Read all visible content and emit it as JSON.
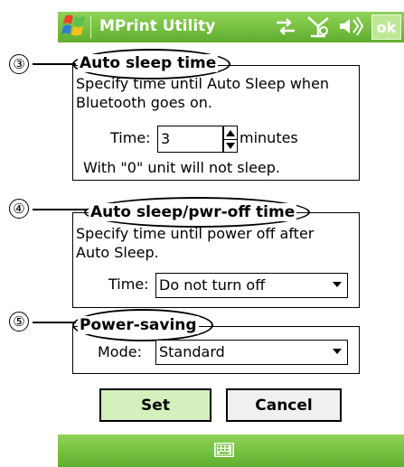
{
  "titlebar": {
    "app_title": "MPrint Utility",
    "ok_label": "ok",
    "icons": [
      "windows-logo",
      "connectivity-icon",
      "network-off-icon",
      "volume-icon"
    ]
  },
  "callouts": {
    "c3": "③",
    "c4": "④",
    "c5": "⑤"
  },
  "auto_sleep": {
    "title": "Auto sleep time",
    "description_line1": "Specify time until Auto Sleep when",
    "description_line2": "Bluetooth goes on.",
    "time_label": "Time:",
    "time_value": "3",
    "unit_label": "minutes",
    "note": "With \"0\" unit will not sleep."
  },
  "auto_off": {
    "title": "Auto sleep/pwr-off time",
    "description_line1": "Specify time until power off after",
    "description_line2": "Auto Sleep.",
    "time_label": "Time:",
    "selected": "Do not turn off"
  },
  "power_saving": {
    "title": "Power-saving",
    "mode_label": "Mode:",
    "selected": "Standard"
  },
  "buttons": {
    "set": "Set",
    "cancel": "Cancel"
  },
  "colors": {
    "bar_green": "#5fae2f",
    "set_button": "#d3f0bd"
  }
}
